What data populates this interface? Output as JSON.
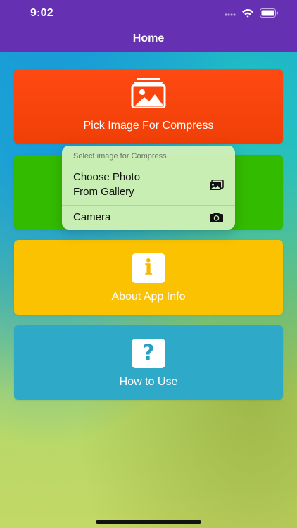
{
  "status_bar": {
    "time": "9:02",
    "icons": [
      "signal-icon",
      "wifi-icon",
      "battery-icon"
    ]
  },
  "nav": {
    "title": "Home"
  },
  "cards": {
    "pick": {
      "label": "Pick Image For Compress",
      "icon": "gallery-icon",
      "color": "#ff4a12"
    },
    "green": {
      "color": "#33bb00"
    },
    "about": {
      "label": "About App Info",
      "icon": "info-icon",
      "icon_glyph": "i",
      "color": "#fac200"
    },
    "howto": {
      "label": "How to Use",
      "icon": "help-icon",
      "icon_glyph": "?",
      "color": "#2fa9c8"
    }
  },
  "popup": {
    "header": "Select image for Compress",
    "items": [
      {
        "label_line1": "Choose Photo",
        "label_line2": "From Gallery",
        "icon": "photo-library-icon"
      },
      {
        "label": "Camera",
        "icon": "camera-icon"
      }
    ]
  }
}
